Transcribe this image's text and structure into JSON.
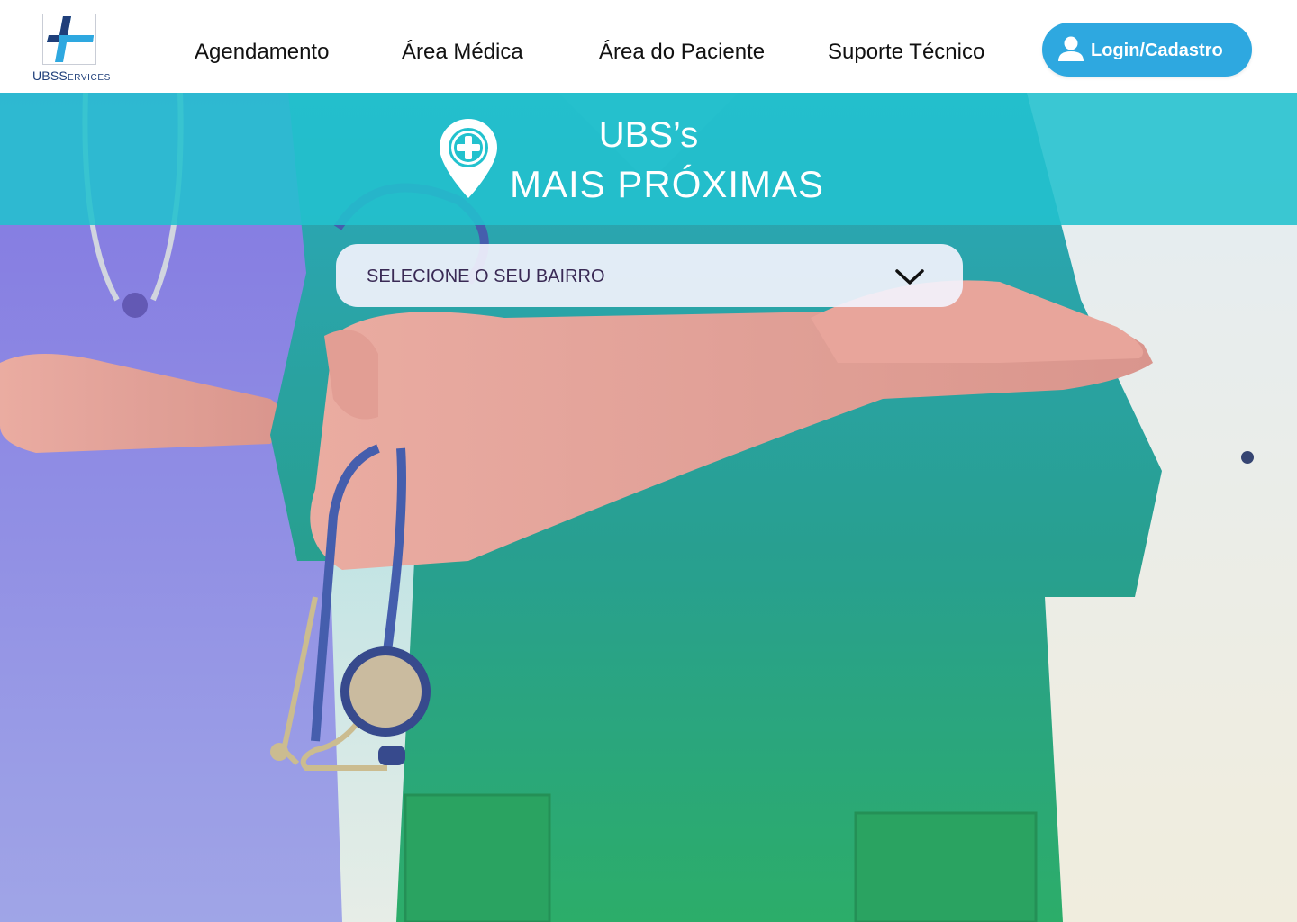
{
  "brand": {
    "logo_main": "UBS",
    "logo_small": "ERVICES",
    "logo_s": "S",
    "logo_colors": [
      "#2ea8e0",
      "#1f3f7a"
    ]
  },
  "nav": {
    "items": [
      {
        "label": "Agendamento"
      },
      {
        "label": "Área Médica"
      },
      {
        "label": "Área do Paciente"
      },
      {
        "label": "Suporte Técnico"
      }
    ],
    "login_label": "Login/Cadastro",
    "login_icon": "user-icon"
  },
  "hero": {
    "title_line1": "UBS’s",
    "title_line2": "MAIS PRÓXIMAS",
    "pin_icon": "map-pin-plus-icon",
    "banner_color": "#22c2ce",
    "select": {
      "placeholder": "SELECIONE O SEU BAIRRO",
      "chevron_icon": "chevron-down-icon"
    }
  },
  "colors": {
    "accent": "#2ea8e0",
    "brand_dark": "#1f3f7a",
    "banner": "#22c2ce"
  }
}
